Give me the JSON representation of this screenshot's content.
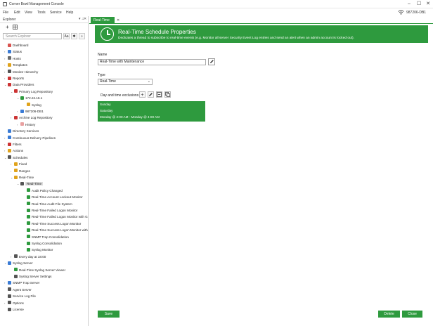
{
  "window": {
    "title": "Corner Bowl Management Console",
    "minimize": "–",
    "maximize": "☐",
    "close": "✕"
  },
  "menu": [
    "File",
    "Edit",
    "View",
    "Tools",
    "Service",
    "Help"
  ],
  "status": {
    "host": "987206-DB1"
  },
  "explorer": {
    "title": "Explorer",
    "search_placeholder": "Search Explorer",
    "tree": [
      {
        "label": "Dashboard",
        "indent": 0,
        "arrow": "",
        "color": "#d9534f"
      },
      {
        "label": "Status",
        "indent": 0,
        "arrow": "›",
        "color": "#3a7bd5"
      },
      {
        "label": "Hosts",
        "indent": 0,
        "arrow": "›",
        "color": "#6a6a6a"
      },
      {
        "label": "Templates",
        "indent": 0,
        "arrow": "›",
        "color": "#e0a31b"
      },
      {
        "label": "Monitor Hierarchy",
        "indent": 0,
        "arrow": "›",
        "color": "#555555"
      },
      {
        "label": "Reports",
        "indent": 0,
        "arrow": "›",
        "color": "#cc3333"
      },
      {
        "label": "Data Providers",
        "indent": 0,
        "arrow": "⌄",
        "color": "#cc3333"
      },
      {
        "label": "Primary Log Repository",
        "indent": 1,
        "arrow": "⌄",
        "color": "#cc3333"
      },
      {
        "label": "172.24.16.1",
        "indent": 2,
        "arrow": "⌄",
        "color": "#2e9a3e"
      },
      {
        "label": "Syslog",
        "indent": 3,
        "arrow": "",
        "color": "#e0a31b"
      },
      {
        "label": "987206-DB1",
        "indent": 2,
        "arrow": "›",
        "color": "#3a7bd5"
      },
      {
        "label": "Archive Log Repository",
        "indent": 1,
        "arrow": "›",
        "color": "#cc3333"
      },
      {
        "label": "History",
        "indent": 2,
        "arrow": "›",
        "color": "#e8a0a0"
      },
      {
        "label": "Directory Services",
        "indent": 0,
        "arrow": "",
        "color": "#3a7bd5"
      },
      {
        "label": "Continuous Delivery Pipelines",
        "indent": 0,
        "arrow": "›",
        "color": "#3a7bd5"
      },
      {
        "label": "Filters",
        "indent": 0,
        "arrow": "›",
        "color": "#cc3333"
      },
      {
        "label": "Actions",
        "indent": 0,
        "arrow": "›",
        "color": "#e0a31b"
      },
      {
        "label": "Schedules",
        "indent": 0,
        "arrow": "⌄",
        "color": "#555555"
      },
      {
        "label": "Fixed",
        "indent": 1,
        "arrow": "›",
        "color": "#e0a31b"
      },
      {
        "label": "Ranges",
        "indent": 1,
        "arrow": "›",
        "color": "#e0a31b"
      },
      {
        "label": "Real-Time",
        "indent": 1,
        "arrow": "⌄",
        "color": "#e0a31b"
      },
      {
        "label": "Real-Time",
        "indent": 2,
        "arrow": "⌄",
        "color": "#555555",
        "selected": true
      },
      {
        "label": "Audit Policy Changed",
        "indent": 3,
        "arrow": "",
        "color": "#2e9a3e"
      },
      {
        "label": "Real-Time Account Lockout Monitor",
        "indent": 3,
        "arrow": "",
        "color": "#2e9a3e"
      },
      {
        "label": "Real-Time Audit File System",
        "indent": 3,
        "arrow": "",
        "color": "#2e9a3e"
      },
      {
        "label": "Real-Time Failed Logon Monitor",
        "indent": 3,
        "arrow": "",
        "color": "#2e9a3e"
      },
      {
        "label": "Real-Time Failed Logon Monitor with G",
        "indent": 3,
        "arrow": "",
        "color": "#2e9a3e"
      },
      {
        "label": "Real-Time Success Logon Monitor",
        "indent": 3,
        "arrow": "",
        "color": "#2e9a3e"
      },
      {
        "label": "Real-Time Success Logon Monitor with",
        "indent": 3,
        "arrow": "",
        "color": "#2e9a3e"
      },
      {
        "label": "SNMP Trap Consolidation",
        "indent": 3,
        "arrow": "",
        "color": "#2e9a3e"
      },
      {
        "label": "Syslog Consolidation",
        "indent": 3,
        "arrow": "",
        "color": "#2e9a3e"
      },
      {
        "label": "Syslog Monitor",
        "indent": 3,
        "arrow": "",
        "color": "#2e9a3e"
      },
      {
        "label": "Every day at 18:00",
        "indent": 1,
        "arrow": "›",
        "color": "#555555"
      },
      {
        "label": "Syslog Server",
        "indent": 0,
        "arrow": "⌄",
        "color": "#3a7bd5"
      },
      {
        "label": "Real-Time Syslog Server Viewer",
        "indent": 1,
        "arrow": "",
        "color": "#2e9a3e"
      },
      {
        "label": "Syslog Server Settings",
        "indent": 1,
        "arrow": "",
        "color": "#555555"
      },
      {
        "label": "SNMP Trap Server",
        "indent": 0,
        "arrow": "›",
        "color": "#3a7bd5"
      },
      {
        "label": "Agent Server",
        "indent": 0,
        "arrow": "",
        "color": "#555555"
      },
      {
        "label": "Service Log File",
        "indent": 0,
        "arrow": "",
        "color": "#555555"
      },
      {
        "label": "Options",
        "indent": 0,
        "arrow": "›",
        "color": "#555555"
      },
      {
        "label": "License",
        "indent": 0,
        "arrow": "",
        "color": "#555555"
      }
    ]
  },
  "tab": {
    "label": "Real-Time",
    "close": "✕"
  },
  "banner": {
    "title": "Real-Time Schedule Properties",
    "description": "Dedicates a thread to subscribe to real-time events (e.g. Monitor all server Security Event Log entries and send an alert when an admin account is locked out)."
  },
  "form": {
    "name_label": "Name",
    "name_value": "Real-Time with Maintenance",
    "type_label": "Type",
    "type_value": "Real-Time",
    "exclusions_label": "Day and time exclusions",
    "exclusions": [
      "Sunday",
      "Saturday",
      "Monday @ 2:00 AM - Monday @ 4:00 AM"
    ]
  },
  "buttons": {
    "save": "Save",
    "delete": "Delete",
    "close": "Close"
  },
  "colors": {
    "accent": "#2e9a3e"
  }
}
